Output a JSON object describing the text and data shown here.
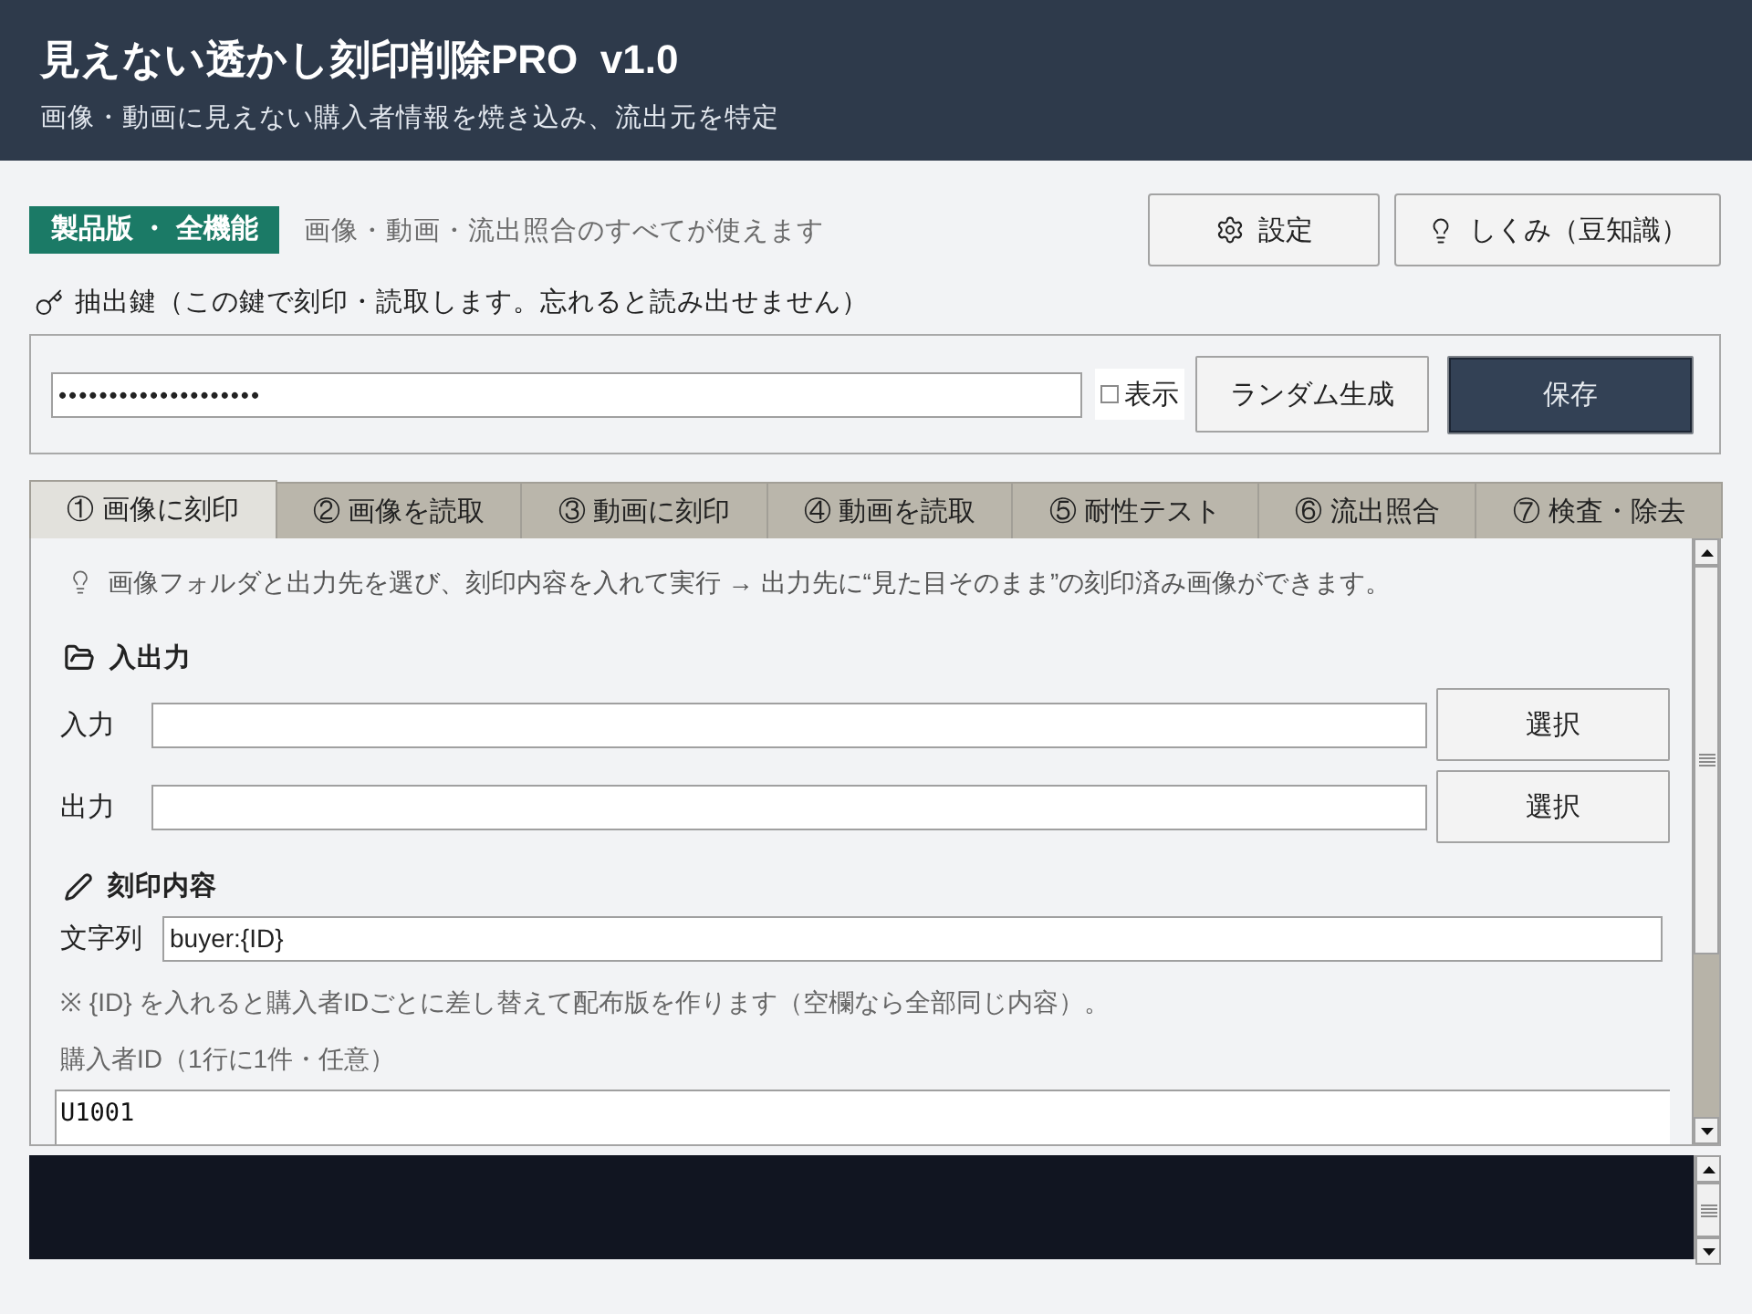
{
  "header": {
    "title": "見えない透かし刻印削除PRO  v1.0",
    "subtitle": "画像・動画に見えない購入者情報を焼き込み、流出元を特定"
  },
  "license": {
    "badge": "製品版 ・ 全機能",
    "text": "画像・動画・流出照合のすべてが使えます"
  },
  "top_buttons": [
    {
      "label": "設定",
      "kind": "settings"
    },
    {
      "label": "しくみ（豆知識）",
      "kind": "tips"
    }
  ],
  "key": {
    "label": "抽出鍵（この鍵で刻印・読取します。忘れると読み出せません）",
    "value": "••••••••••••••••••••",
    "show": {
      "label": "表示",
      "checked": false
    },
    "buttons": [
      {
        "label": "ランダム生成",
        "kind": "normal"
      },
      {
        "label": "保存",
        "kind": "primary"
      }
    ]
  },
  "tabs": [
    {
      "label": "① 画像に刻印",
      "selected": true
    },
    {
      "label": "② 画像を読取",
      "selected": false
    },
    {
      "label": "③ 動画に刻印",
      "selected": false
    },
    {
      "label": "④ 動画を読取",
      "selected": false
    },
    {
      "label": "⑤ 耐性テスト",
      "selected": false
    },
    {
      "label": "⑥ 流出照合",
      "selected": false
    },
    {
      "label": "⑦ 検査・除去",
      "selected": false
    }
  ],
  "panel": {
    "hint": "画像フォルダと出力先を選び、刻印内容を入れて実行 → 出力先に“見た目そのまま”の刻印済み画像ができます。",
    "io": {
      "title": "入出力",
      "rows": [
        {
          "label": "入力",
          "button": "選択"
        },
        {
          "label": "出力",
          "button": "選択"
        }
      ]
    },
    "engrave": {
      "title": "刻印内容",
      "string_label": "文字列",
      "string_value": "buyer:{ID}",
      "note": "※ {ID} を入れると購入者IDごとに差し替えて配布版を作ります（空欄なら全部同じ内容）。",
      "ids_label": "購入者ID（1行に1件・任意）",
      "ids": [
        "U1001"
      ]
    }
  }
}
